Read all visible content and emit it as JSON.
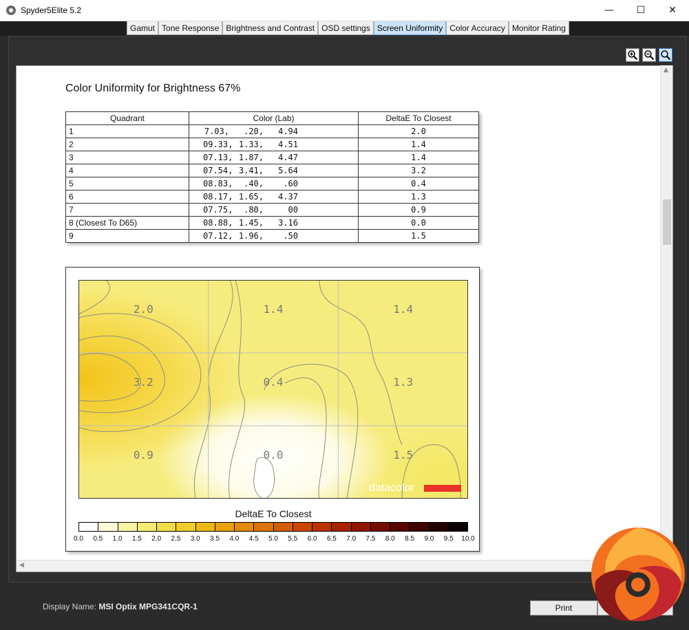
{
  "window": {
    "title": "Spyder5Elite 5.2",
    "minimize_glyph": "—",
    "maximize_glyph": "☐",
    "close_glyph": "✕"
  },
  "tabs": [
    {
      "label": "Gamut",
      "active": false
    },
    {
      "label": "Tone Response",
      "active": false
    },
    {
      "label": "Brightness and Contrast",
      "active": false
    },
    {
      "label": "OSD settings",
      "active": false
    },
    {
      "label": "Screen Uniformity",
      "active": true
    },
    {
      "label": "Color Accuracy",
      "active": false
    },
    {
      "label": "Monitor Rating",
      "active": false
    }
  ],
  "toolbar": {
    "icons": [
      "zoom-in-icon",
      "zoom-out-icon",
      "zoom-fit-icon"
    ]
  },
  "report": {
    "title": "Color Uniformity for Brightness 67%",
    "table": {
      "headers": [
        "Quadrant",
        "Color (Lab)",
        "DeltaE To Closest"
      ],
      "rows": [
        {
          "quadrant": "1",
          "lab": [
            "7.03,",
            ".20,",
            "4.94"
          ],
          "delta": "2.0"
        },
        {
          "quadrant": "2",
          "lab": [
            "09.33,",
            "1.33,",
            "4.51"
          ],
          "delta": "1.4"
        },
        {
          "quadrant": "3",
          "lab": [
            "07.13,",
            "1.87,",
            "4.47"
          ],
          "delta": "1.4"
        },
        {
          "quadrant": "4",
          "lab": [
            "07.54,",
            "3.41,",
            "5.64"
          ],
          "delta": "3.2"
        },
        {
          "quadrant": "5",
          "lab": [
            "08.83,",
            ".40,",
            ".60"
          ],
          "delta": "0.4"
        },
        {
          "quadrant": "6",
          "lab": [
            "08.17,",
            "1.65,",
            "4.37"
          ],
          "delta": "1.3"
        },
        {
          "quadrant": "7",
          "lab": [
            "07.75,",
            ".80,",
            "00"
          ],
          "delta": "0.9"
        },
        {
          "quadrant": "8 (Closest To D65)",
          "lab": [
            "08.88,",
            "1.45,",
            "3.16"
          ],
          "delta": "0.0"
        },
        {
          "quadrant": "9",
          "lab": [
            "07.12,",
            "1.96,",
            ".50"
          ],
          "delta": "1.5"
        }
      ]
    },
    "uniformity_map": {
      "grid_values": [
        [
          "2.0",
          "1.4",
          "1.4"
        ],
        [
          "3.2",
          "0.4",
          "1.3"
        ],
        [
          "0.9",
          "0.0",
          "1.5"
        ]
      ],
      "watermark": "datacolor",
      "watermark_accent": "#e8322a"
    },
    "legend": {
      "title": "DeltaE To Closest",
      "ticks": [
        "0.0",
        "0.5",
        "1.0",
        "1.5",
        "2.0",
        "2.5",
        "3.0",
        "3.5",
        "4.0",
        "4.5",
        "5.0",
        "5.5",
        "6.0",
        "6.5",
        "7.0",
        "7.5",
        "8.0",
        "8.5",
        "9.0",
        "9.5",
        "10.0"
      ],
      "colors": [
        "#ffffff",
        "#fdfbd6",
        "#f9f3a3",
        "#f5ea72",
        "#f2dd48",
        "#f0cc2a",
        "#edb816",
        "#e9a10c",
        "#e38a08",
        "#dc7305",
        "#d45d03",
        "#c94702",
        "#ba3401",
        "#a62401",
        "#8e1701",
        "#740e01",
        "#580801",
        "#3d0401",
        "#240201",
        "#0a0000"
      ]
    }
  },
  "footer": {
    "display_name_label": "Display Name:",
    "display_name_value": "MSI Optix MPG341CQR-1",
    "print_label": "Print"
  }
}
